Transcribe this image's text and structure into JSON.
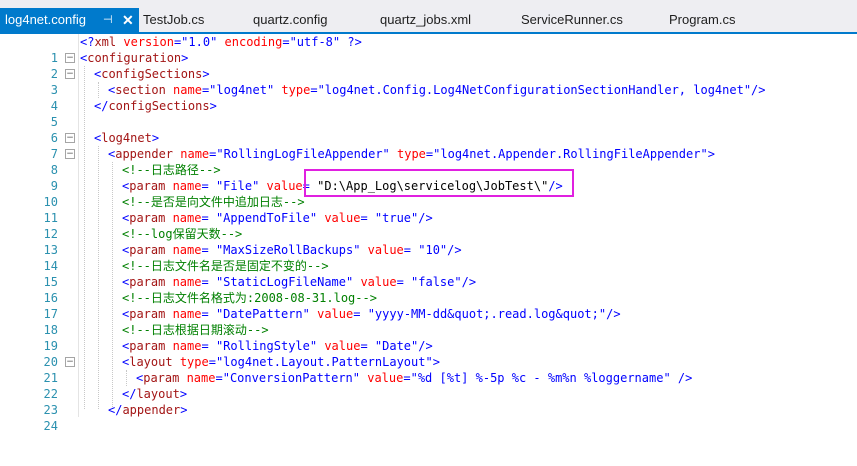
{
  "tabs": [
    {
      "label": "log4net.config",
      "pin": "⊣",
      "close": "✕"
    },
    {
      "label": "TestJob.cs"
    },
    {
      "label": "quartz.config"
    },
    {
      "label": "quartz_jobs.xml"
    },
    {
      "label": "ServiceRunner.cs"
    },
    {
      "label": "Program.cs"
    }
  ],
  "lines": [
    {
      "n": "1",
      "fold": ""
    },
    {
      "n": "2",
      "fold": "−"
    },
    {
      "n": "3",
      "fold": "−"
    },
    {
      "n": "4",
      "fold": ""
    },
    {
      "n": "5",
      "fold": ""
    },
    {
      "n": "6",
      "fold": ""
    },
    {
      "n": "7",
      "fold": "−"
    },
    {
      "n": "8",
      "fold": "−"
    },
    {
      "n": "9",
      "fold": ""
    },
    {
      "n": "10",
      "fold": ""
    },
    {
      "n": "11",
      "fold": ""
    },
    {
      "n": "12",
      "fold": ""
    },
    {
      "n": "13",
      "fold": ""
    },
    {
      "n": "14",
      "fold": ""
    },
    {
      "n": "15",
      "fold": ""
    },
    {
      "n": "16",
      "fold": ""
    },
    {
      "n": "17",
      "fold": ""
    },
    {
      "n": "18",
      "fold": ""
    },
    {
      "n": "19",
      "fold": ""
    },
    {
      "n": "20",
      "fold": ""
    },
    {
      "n": "21",
      "fold": "−"
    },
    {
      "n": "22",
      "fold": ""
    },
    {
      "n": "23",
      "fold": ""
    },
    {
      "n": "24",
      "fold": ""
    }
  ],
  "code": {
    "l1": {
      "a": "<?",
      "b": "xml",
      "c": " version",
      "d": "=",
      "e": "\"1.0\"",
      "f": " encoding",
      "g": "=",
      "h": "\"utf-8\"",
      "i": " ?>"
    },
    "l2": {
      "a": "<",
      "b": "configuration",
      "c": ">"
    },
    "l3": {
      "a": "<",
      "b": "configSections",
      "c": ">"
    },
    "l4": {
      "a": "<",
      "b": "section",
      "c": " name",
      "d": "=",
      "e": "\"log4net\"",
      "f": " type",
      "g": "=",
      "h": "\"log4net.Config.Log4NetConfigurationSectionHandler, log4net\"",
      "i": "/>"
    },
    "l5": {
      "a": "</",
      "b": "configSections",
      "c": ">"
    },
    "l7": {
      "a": "<",
      "b": "log4net",
      "c": ">"
    },
    "l8": {
      "a": "<",
      "b": "appender",
      "c": " name",
      "d": "=",
      "e": "\"RollingLogFileAppender\"",
      "f": " type",
      "g": "=",
      "h": "\"log4net.Appender.RollingFileAppender\"",
      "i": ">"
    },
    "l9": {
      "a": "<!--",
      "b": "日志路径",
      "c": "-->"
    },
    "l10": {
      "a": "<",
      "b": "param",
      "c": " name",
      "d": "=",
      "e": " \"File\"",
      "f": " value",
      "g": "=",
      "h": " \"D:\\App_Log\\servicelog\\JobTest\\\"",
      "i": "/>"
    },
    "l11": {
      "a": "<!--",
      "b": "是否是向文件中追加日志",
      "c": "-->"
    },
    "l12": {
      "a": "<",
      "b": "param",
      "c": " name",
      "d": "=",
      "e": " \"AppendToFile\"",
      "f": " value",
      "g": "=",
      "h": " \"true\"",
      "i": "/>"
    },
    "l13": {
      "a": "<!--",
      "b": "log保留天数",
      "c": "-->"
    },
    "l14": {
      "a": "<",
      "b": "param",
      "c": " name",
      "d": "=",
      "e": " \"MaxSizeRollBackups\"",
      "f": " value",
      "g": "=",
      "h": " \"10\"",
      "i": "/>"
    },
    "l15": {
      "a": "<!--",
      "b": "日志文件名是否是固定不变的",
      "c": "-->"
    },
    "l16": {
      "a": "<",
      "b": "param",
      "c": " name",
      "d": "=",
      "e": " \"StaticLogFileName\"",
      "f": " value",
      "g": "=",
      "h": " \"false\"",
      "i": "/>"
    },
    "l17": {
      "a": "<!--",
      "b": "日志文件名格式为:2008-08-31.log",
      "c": "-->"
    },
    "l18": {
      "a": "<",
      "b": "param",
      "c": " name",
      "d": "=",
      "e": " \"DatePattern\"",
      "f": " value",
      "g": "=",
      "h": " \"yyyy-MM-dd&quot;.read.log&quot;\"",
      "i": "/>"
    },
    "l19": {
      "a": "<!--",
      "b": "日志根据日期滚动",
      "c": "-->"
    },
    "l20": {
      "a": "<",
      "b": "param",
      "c": " name",
      "d": "=",
      "e": " \"RollingStyle\"",
      "f": " value",
      "g": "=",
      "h": " \"Date\"",
      "i": "/>"
    },
    "l21": {
      "a": "<",
      "b": "layout",
      "c": " type",
      "d": "=",
      "e": "\"log4net.Layout.PatternLayout\"",
      "f": ">"
    },
    "l22": {
      "a": "<",
      "b": "param",
      "c": " name",
      "d": "=",
      "e": "\"ConversionPattern\"",
      "f": " value",
      "g": "=",
      "h": "\"%d [%t] %-5p %c - %m%n %loggername\"",
      "i": " />"
    },
    "l23": {
      "a": "</",
      "b": "layout",
      "c": ">"
    },
    "l24": {
      "a": "</",
      "b": "appender",
      "c": ">"
    }
  }
}
